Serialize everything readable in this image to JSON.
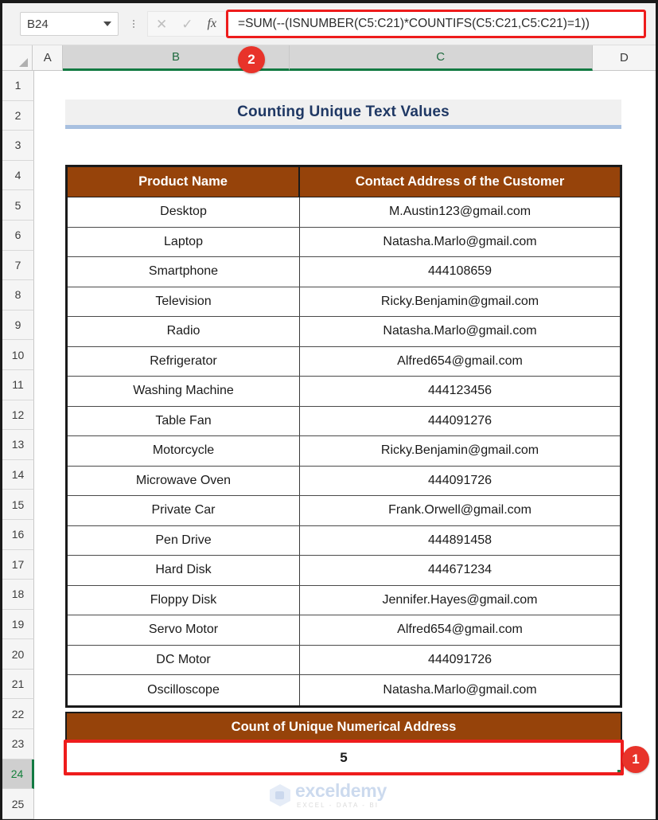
{
  "formula_bar": {
    "name_box_value": "B24",
    "formula": "=SUM(--(ISNUMBER(C5:C21)*COUNTIFS(C5:C21,C5:C21)=1))",
    "cancel_icon": "close-icon",
    "confirm_icon": "check-icon",
    "function_icon": "fx-icon",
    "cancel_glyph": "✕",
    "confirm_glyph": "✓",
    "fx_glyph": "fx"
  },
  "columns": [
    {
      "label": "A",
      "selected": false
    },
    {
      "label": "B",
      "selected": true
    },
    {
      "label": "C",
      "selected": true
    },
    {
      "label": "D",
      "selected": false
    }
  ],
  "rows": [
    {
      "num": "1",
      "selected": false
    },
    {
      "num": "2",
      "selected": false
    },
    {
      "num": "3",
      "selected": false
    },
    {
      "num": "4",
      "selected": false
    },
    {
      "num": "5",
      "selected": false
    },
    {
      "num": "6",
      "selected": false
    },
    {
      "num": "7",
      "selected": false
    },
    {
      "num": "8",
      "selected": false
    },
    {
      "num": "9",
      "selected": false
    },
    {
      "num": "10",
      "selected": false
    },
    {
      "num": "11",
      "selected": false
    },
    {
      "num": "12",
      "selected": false
    },
    {
      "num": "13",
      "selected": false
    },
    {
      "num": "14",
      "selected": false
    },
    {
      "num": "15",
      "selected": false
    },
    {
      "num": "16",
      "selected": false
    },
    {
      "num": "17",
      "selected": false
    },
    {
      "num": "18",
      "selected": false
    },
    {
      "num": "19",
      "selected": false
    },
    {
      "num": "20",
      "selected": false
    },
    {
      "num": "21",
      "selected": false
    },
    {
      "num": "22",
      "selected": false
    },
    {
      "num": "23",
      "selected": false
    },
    {
      "num": "24",
      "selected": true
    },
    {
      "num": "25",
      "selected": false
    }
  ],
  "sheet": {
    "title": "Counting Unique Text Values",
    "table": {
      "headers": [
        "Product Name",
        "Contact Address of the Customer"
      ],
      "rows": [
        [
          "Desktop",
          "M.Austin123@gmail.com"
        ],
        [
          "Laptop",
          "Natasha.Marlo@gmail.com"
        ],
        [
          "Smartphone",
          "444108659"
        ],
        [
          "Television",
          "Ricky.Benjamin@gmail.com"
        ],
        [
          "Radio",
          "Natasha.Marlo@gmail.com"
        ],
        [
          "Refrigerator",
          "Alfred654@gmail.com"
        ],
        [
          "Washing Machine",
          "444123456"
        ],
        [
          "Table Fan",
          "444091276"
        ],
        [
          "Motorcycle",
          "Ricky.Benjamin@gmail.com"
        ],
        [
          "Microwave Oven",
          "444091726"
        ],
        [
          "Private Car",
          "Frank.Orwell@gmail.com"
        ],
        [
          "Pen Drive",
          "444891458"
        ],
        [
          "Hard Disk",
          "444671234"
        ],
        [
          "Floppy Disk",
          "Jennifer.Hayes@gmail.com"
        ],
        [
          "Servo Motor",
          "Alfred654@gmail.com"
        ],
        [
          "DC Motor",
          "444091726"
        ],
        [
          "Oscilloscope",
          "Natasha.Marlo@gmail.com"
        ]
      ]
    },
    "summary": {
      "header": "Count of Unique Numerical Address",
      "value": "5"
    }
  },
  "annotations": [
    {
      "id": "1",
      "label": "1"
    },
    {
      "id": "2",
      "label": "2"
    }
  ],
  "watermark": {
    "name": "exceldemy",
    "tagline": "EXCEL - DATA - BI"
  },
  "colors": {
    "header_brown": "#96430A",
    "title_navy": "#1F3864",
    "annotation_red": "#EE1C1C",
    "badge_red": "#E8332A",
    "selection_green": "#1F7A46"
  }
}
